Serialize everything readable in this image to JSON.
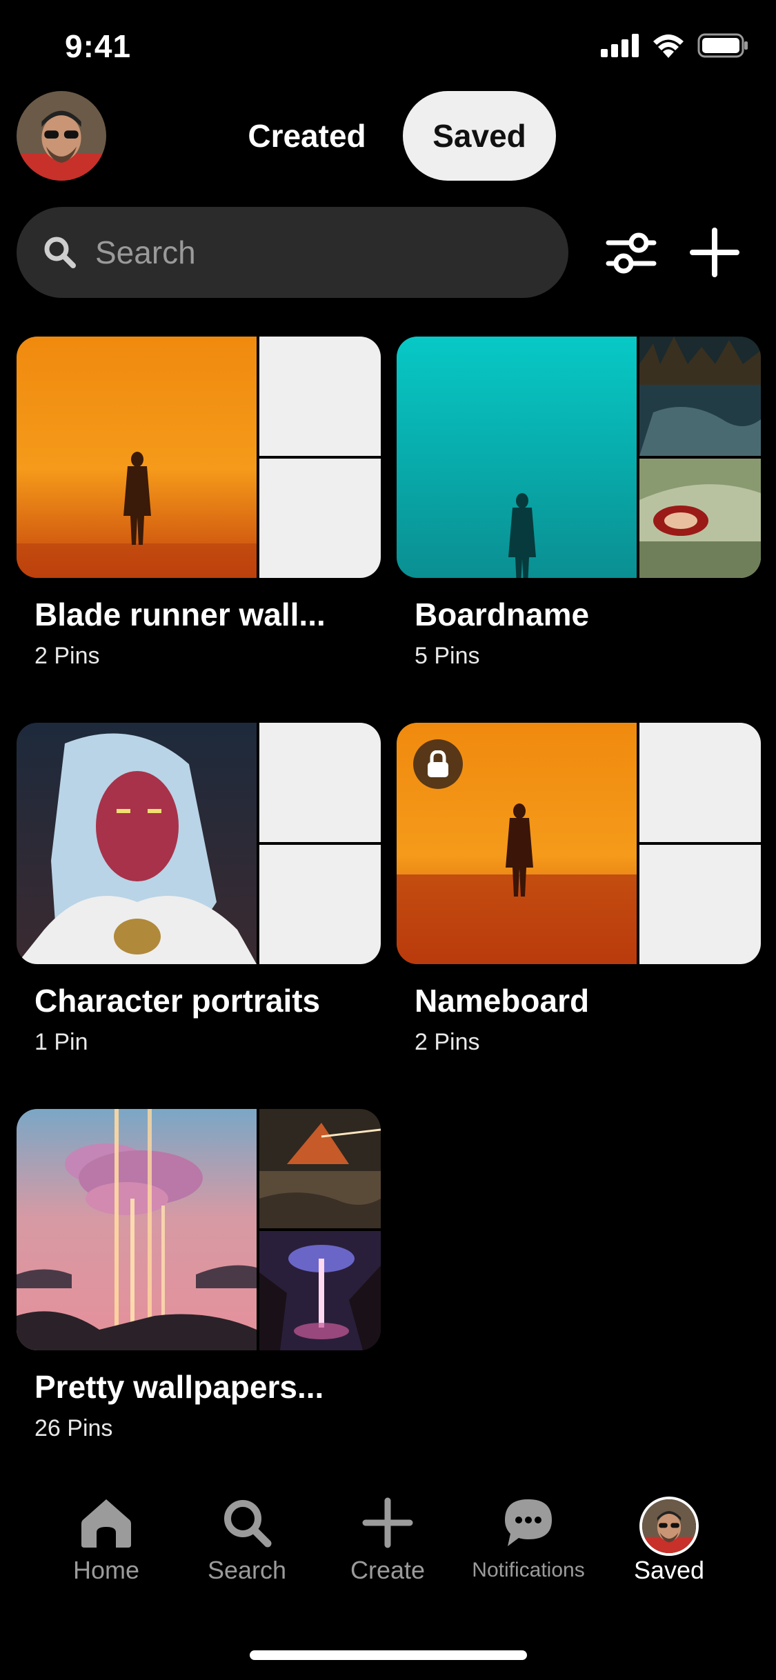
{
  "status_bar": {
    "time": "9:41"
  },
  "header": {
    "tabs": [
      {
        "label": "Created",
        "active": false
      },
      {
        "label": "Saved",
        "active": true
      }
    ]
  },
  "search": {
    "placeholder": "Search"
  },
  "boards": [
    {
      "title": "Blade runner wall...",
      "count": "2 Pins",
      "locked": false
    },
    {
      "title": "Boardname",
      "count": "5 Pins",
      "locked": false
    },
    {
      "title": "Character portraits",
      "count": "1 Pin",
      "locked": false
    },
    {
      "title": "Nameboard",
      "count": "2 Pins",
      "locked": true
    },
    {
      "title": "Pretty wallpapers...",
      "count": "26 Pins",
      "locked": false
    }
  ],
  "bottom_nav": {
    "items": [
      {
        "label": "Home",
        "icon": "home-icon",
        "active": false
      },
      {
        "label": "Search",
        "icon": "search-icon",
        "active": false
      },
      {
        "label": "Create",
        "icon": "plus-icon",
        "active": false
      },
      {
        "label": "Notifications",
        "icon": "chat-bubble-icon",
        "active": false
      },
      {
        "label": "Saved",
        "icon": "avatar",
        "active": true
      }
    ]
  },
  "colors": {
    "background": "#000000",
    "search_field": "#2b2b2b",
    "active_tab_bg": "#efefef",
    "inactive_nav": "#9b9b9b"
  }
}
